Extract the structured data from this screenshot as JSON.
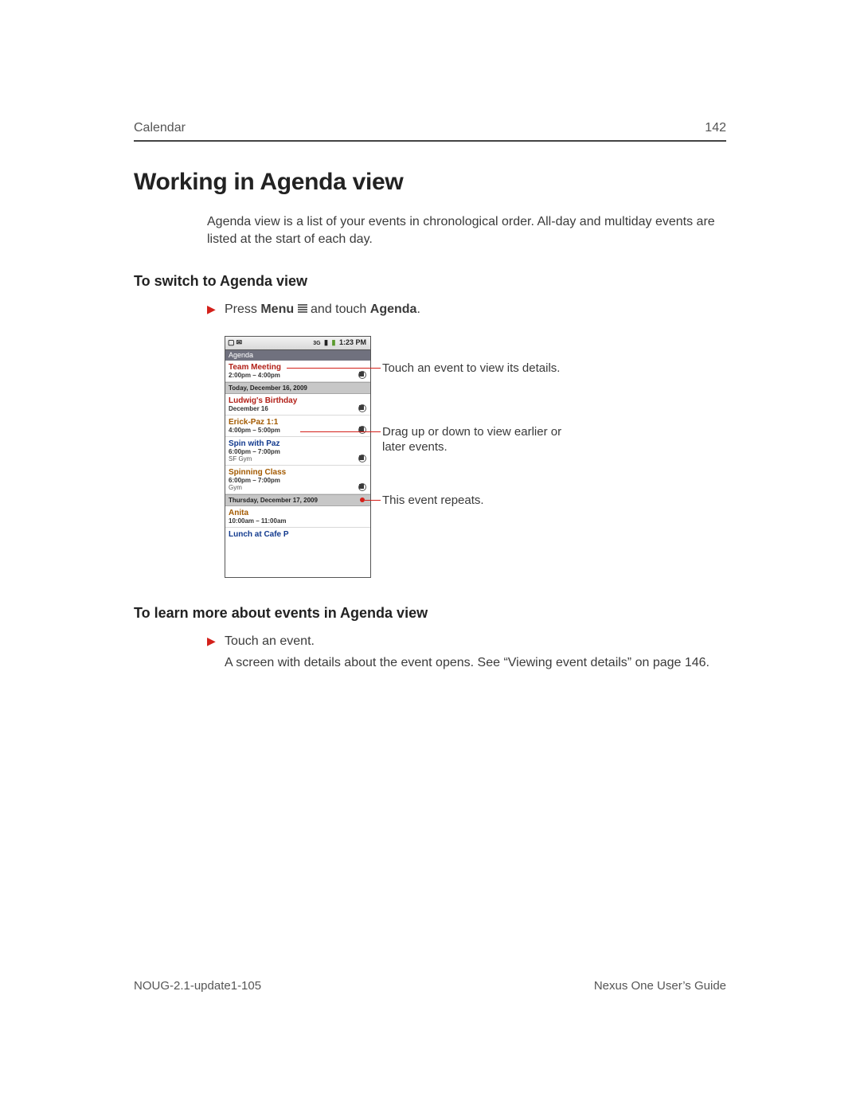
{
  "header": {
    "section": "Calendar",
    "page_number": "142"
  },
  "title": "Working in Agenda view",
  "intro": "Agenda view is a list of your events in chronological order. All-day and multiday events are listed at the start of each day.",
  "section_a": {
    "heading": "To switch to Agenda view",
    "bullet_pre": "Press ",
    "bullet_bold1": "Menu",
    "bullet_mid": " and touch ",
    "bullet_bold2": "Agenda",
    "bullet_post": "."
  },
  "section_b": {
    "heading": "To learn more about events in Agenda view",
    "bullet": "Touch an event.",
    "follow": "A screen with details about the event opens. See “Viewing event details” on page 146."
  },
  "callouts": {
    "touch_event": "Touch an event to view its details.",
    "drag": "Drag up or down to view earlier or later events.",
    "repeats": "This event repeats."
  },
  "phone": {
    "status_time": "1:23 PM",
    "agenda_label": "Agenda",
    "date_today": "Today, December 16, 2009",
    "date_tomorrow": "Thursday, December 17, 2009",
    "events": {
      "team": {
        "title": "Team Meeting",
        "time": "2:00pm – 4:00pm"
      },
      "ludwig": {
        "title": "Ludwig's Birthday",
        "time": "December 16"
      },
      "erick": {
        "title": "Erick-Paz 1:1",
        "time": "4:00pm – 5:00pm"
      },
      "spin": {
        "title": "Spin with Paz",
        "time": "6:00pm – 7:00pm",
        "loc": "SF Gym"
      },
      "spincl": {
        "title": "Spinning Class",
        "time": "6:00pm – 7:00pm",
        "loc": "Gym"
      },
      "anita": {
        "title": "Anita",
        "time": "10:00am – 11:00am"
      },
      "lunch": {
        "title": "Lunch at Cafe P",
        "time": ""
      }
    }
  },
  "footer": {
    "left": "NOUG-2.1-update1-105",
    "right": "Nexus One User’s Guide"
  }
}
